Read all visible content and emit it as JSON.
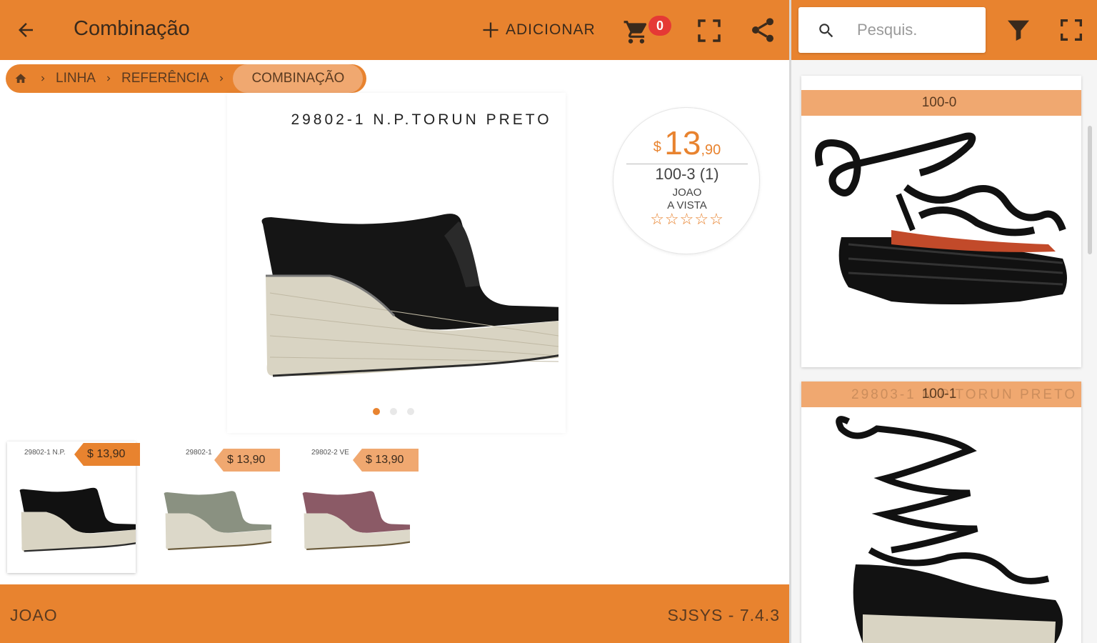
{
  "header": {
    "title": "Combinação",
    "add_label": "ADICIONAR",
    "cart_count": "0"
  },
  "breadcrumb": {
    "items": [
      "LINHA",
      "REFERÊNCIA"
    ],
    "active": "COMBINAÇÃO"
  },
  "product": {
    "name": "29802-1 N.P.TORUN PRETO",
    "price_currency": "$",
    "price_integer": "13",
    "price_decimal": ",90",
    "reference": "100-3 (1)",
    "seller": "JOAO",
    "payment_condition": "A VISTA",
    "rating_stars": "☆☆☆☆☆",
    "image_count": 3,
    "current_image": 1
  },
  "thumbnails": [
    {
      "name": "29802-1 N.P.",
      "price": "$ 13,90",
      "color": "#111111",
      "selected": true
    },
    {
      "name": "29802-1",
      "price": "$ 13,90",
      "color": "#8a9181",
      "selected": false
    },
    {
      "name": "29802-2 VE",
      "price": "$ 13,90",
      "color": "#8b5a66",
      "selected": false
    }
  ],
  "footer": {
    "user": "JOAO",
    "version": "SJSYS - 7.4.3"
  },
  "sidebar": {
    "search_placeholder": "Pesquis.",
    "cards": [
      {
        "label": "100-0"
      },
      {
        "label": "100-1",
        "ghost": "29803-1 N.P.TORUN PRETO"
      }
    ]
  },
  "colors": {
    "accent": "#e8832f",
    "accent_light": "#f0a870",
    "badge": "#e53935"
  }
}
